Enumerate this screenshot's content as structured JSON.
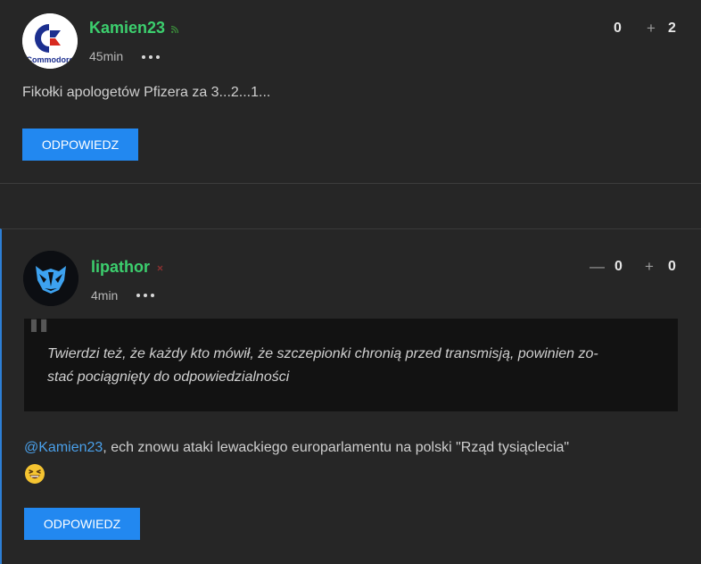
{
  "comments": [
    {
      "username": "Kamien23",
      "avatar_text": "Commodore",
      "time": "45min",
      "status_icon": "rss-icon",
      "votes": {
        "down": "0",
        "up_sign": "+",
        "up": "2"
      },
      "body": "Fikołki apologetów Pfizera za 3...2...1...",
      "reply_label": "ODPOWIEDZ"
    },
    {
      "username": "lipathor",
      "time": "4min",
      "status_icon": "dot-icon",
      "votes": {
        "down_sign": "—",
        "down": "0",
        "up_sign": "+",
        "up": "0"
      },
      "quote_mark": "\"",
      "quote_line1": "Twierdzi też, że każdy kto mówił, że szczepionki chronią przed transmisją, powinien zo-",
      "quote_line2": "stać pociągnięty do odpowiedzialności",
      "mention": "@Kamien23",
      "body": ", ech znowu ataki lewackiego europarlamentu na polski \"Rząd tysiąclecia\"",
      "emoji": "laughing-emoji",
      "reply_label": "ODPOWIEDZ"
    }
  ],
  "colors": {
    "background": "#262626",
    "username": "#3ccf6e",
    "accent": "#2288f0",
    "mention": "#4aa0ea",
    "quote_background": "#121212"
  }
}
